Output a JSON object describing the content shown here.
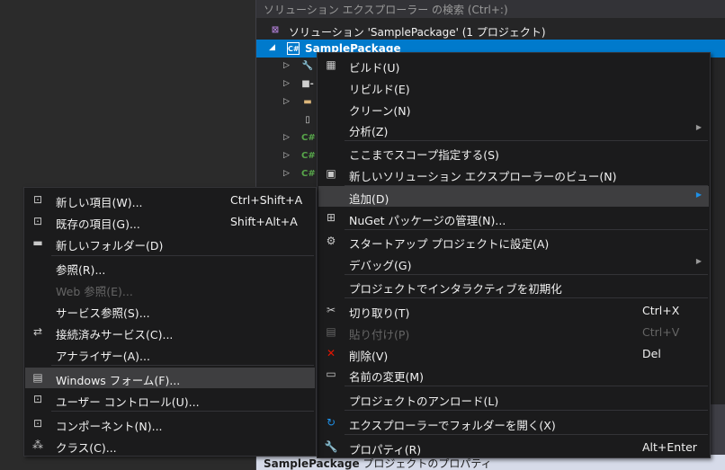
{
  "solution_explorer": {
    "search_placeholder": "ソリューション エクスプローラー の検索 (Ctrl+:)",
    "solution_label": "ソリューション 'SamplePackage' (1 プロジェクト)",
    "project_label": "SamplePackage",
    "status_bold": "SamplePackage",
    "status_rest": " プロジェクトのプロパティ"
  },
  "context_menu": {
    "build": "ビルド(U)",
    "rebuild": "リビルド(E)",
    "clean": "クリーン(N)",
    "analyze": "分析(Z)",
    "scope": "ここまでスコープ指定する(S)",
    "new_view": "新しいソリューション エクスプローラーのビュー(N)",
    "add": "追加(D)",
    "nuget": "NuGet パッケージの管理(N)...",
    "startup": "スタートアップ プロジェクトに設定(A)",
    "debug": "デバッグ(G)",
    "interactive": "プロジェクトでインタラクティブを初期化",
    "cut": "切り取り(T)",
    "cut_shortcut": "Ctrl+X",
    "paste": "貼り付け(P)",
    "paste_shortcut": "Ctrl+V",
    "delete": "削除(V)",
    "delete_shortcut": "Del",
    "rename": "名前の変更(M)",
    "unload": "プロジェクトのアンロード(L)",
    "open_folder": "エクスプローラーでフォルダーを開く(X)",
    "properties": "プロパティ(R)",
    "properties_shortcut": "Alt+Enter"
  },
  "add_submenu": {
    "new_item": "新しい項目(W)...",
    "new_item_shortcut": "Ctrl+Shift+A",
    "existing_item": "既存の項目(G)...",
    "existing_item_shortcut": "Shift+Alt+A",
    "new_folder": "新しいフォルダー(D)",
    "reference": "参照(R)...",
    "web_reference": "Web 参照(E)...",
    "service_reference": "サービス参照(S)...",
    "connected_service": "接続済みサービス(C)...",
    "analyzer": "アナライザー(A)...",
    "windows_form": "Windows フォーム(F)...",
    "user_control": "ユーザー コントロール(U)...",
    "component": "コンポーネント(N)...",
    "class": "クラス(C)..."
  },
  "colors": {
    "selection": "#007acc",
    "menu_bg": "#1b1b1c",
    "highlight": "#3e3e40"
  }
}
